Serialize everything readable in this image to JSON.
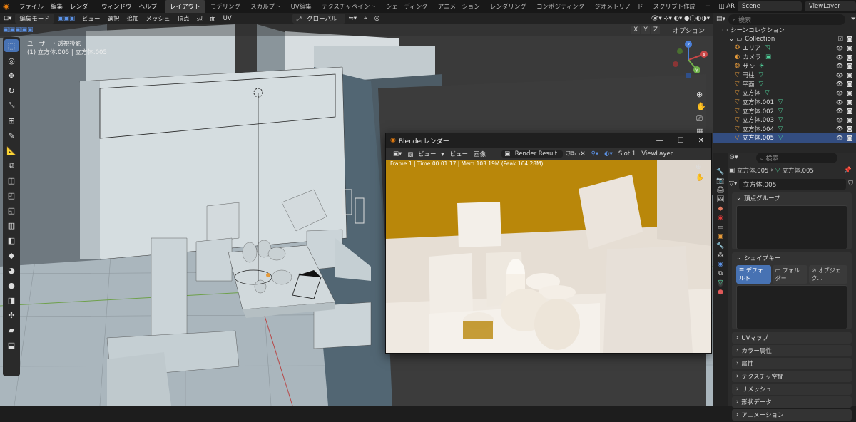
{
  "topbar": {
    "menus": [
      "ファイル",
      "編集",
      "レンダー",
      "ウィンドウ",
      "ヘルプ"
    ],
    "workspaces": [
      "レイアウト",
      "モデリング",
      "スカルプト",
      "UV編集",
      "テクスチャペイント",
      "シェーディング",
      "アニメーション",
      "レンダリング",
      "コンポジティング",
      "ジオメトリノード",
      "スクリプト作成"
    ],
    "add_tab": "+",
    "ar_label": "AR",
    "scene": "Scene",
    "view_layer": "ViewLayer"
  },
  "viewport_header": {
    "mode": "編集モード",
    "menus": [
      "ビュー",
      "選択",
      "追加",
      "メッシュ",
      "頂点",
      "辺",
      "面",
      "UV"
    ],
    "transform": "グローバル",
    "axes": [
      "X",
      "Y",
      "Z"
    ],
    "options": "オプション"
  },
  "viewport": {
    "view_name": "ユーザー・透視投影",
    "object_info": "(1) 立方体.005 | 立方体.005",
    "gizmo_axes": [
      "X",
      "Y",
      "Z"
    ]
  },
  "outliner": {
    "search_placeholder": "検索",
    "scene_collection": "シーンコレクション",
    "collection": "Collection",
    "items": [
      {
        "name": "エリア",
        "type": "light"
      },
      {
        "name": "カメラ",
        "type": "camera"
      },
      {
        "name": "サン",
        "type": "light"
      },
      {
        "name": "円柱",
        "type": "mesh"
      },
      {
        "name": "平面",
        "type": "mesh"
      },
      {
        "name": "立方体",
        "type": "mesh"
      },
      {
        "name": "立方体.001",
        "type": "mesh"
      },
      {
        "name": "立方体.002",
        "type": "mesh"
      },
      {
        "name": "立方体.003",
        "type": "mesh"
      },
      {
        "name": "立方体.004",
        "type": "mesh"
      },
      {
        "name": "立方体.005",
        "type": "mesh",
        "selected": true
      }
    ]
  },
  "render_window": {
    "title": "Blenderレンダー",
    "view_menu": "ビュー",
    "view": "ビュー",
    "image": "画像",
    "result": "Render Result",
    "slot": "Slot 1",
    "view_layer": "ViewLayer",
    "stats": "Frame:1 | Time:00:01.17 | Mem:103.19M (Peak 164.28M)"
  },
  "properties": {
    "search_placeholder": "検索",
    "breadcrumb_obj": "立方体.005",
    "breadcrumb_mesh": "立方体.005",
    "mesh_name": "立方体.005",
    "vertex_groups": "頂点グループ",
    "shape_keys": "シェイプキー",
    "shape_tabs": [
      "デフォルト",
      "フォルダー",
      "オブジェク..."
    ],
    "sections": [
      "UVマップ",
      "カラー属性",
      "属性",
      "テクスチャ空間",
      "リメッシュ",
      "形状データ",
      "アニメーション"
    ]
  },
  "colors": {
    "accent": "#4772b3",
    "selected_row": "#334d80",
    "render_amber": "#b9870a"
  }
}
